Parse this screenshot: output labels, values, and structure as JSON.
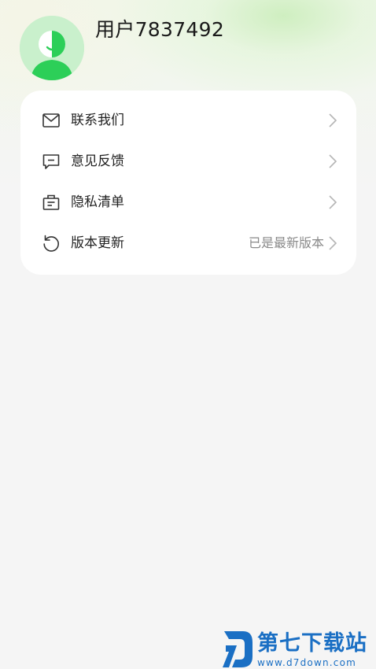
{
  "profile": {
    "username": "用户7837492"
  },
  "menu": {
    "items": [
      {
        "label": "联系我们",
        "icon": "mail-icon",
        "value": ""
      },
      {
        "label": "意见反馈",
        "icon": "feedback-icon",
        "value": ""
      },
      {
        "label": "隐私清单",
        "icon": "privacy-list-icon",
        "value": ""
      },
      {
        "label": "版本更新",
        "icon": "update-icon",
        "value": "已是最新版本"
      }
    ]
  },
  "watermark": {
    "title": "第七下载站",
    "url": "www.d7down.com"
  },
  "colors": {
    "avatar_light": "#c9f0cc",
    "avatar_dark": "#2ccf58",
    "card_background": "#ffffff",
    "page_background": "#f5f5f5",
    "watermark": "#1a6fc4"
  }
}
